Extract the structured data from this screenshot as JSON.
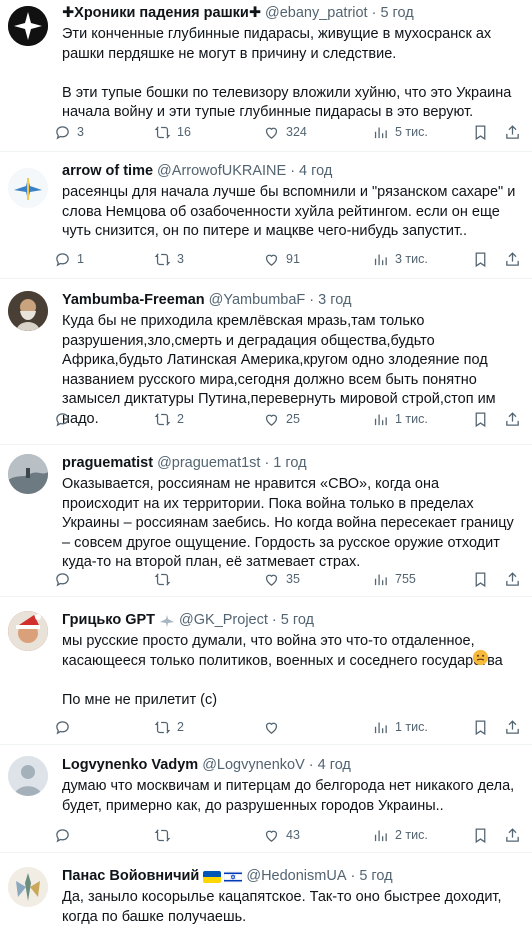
{
  "colors": {
    "text": "#0f1419",
    "muted": "#536471",
    "divider": "#eff3f4"
  },
  "icons": [
    "reply-icon",
    "retweet-icon",
    "like-icon",
    "views-icon",
    "bookmark-icon",
    "share-icon"
  ],
  "tweets": [
    {
      "name": "✚Хроники падения рашки✚",
      "handle": "@ebany_patriot",
      "separator": "·",
      "time": "5 год",
      "text": "Эти конченные глубинные пидарасы, живущие в мухосранск ах рашки пердяшке не могут в причину и следствие.\n\nВ эти тупые бошки по телевизору вложили хуйню, что это Украина начала войну и эти тупые глубинные пидарасы в это веруют.",
      "replies": "3",
      "retweets": "16",
      "likes": "324",
      "views": "5 тис."
    },
    {
      "name": "arrow of time",
      "handle": "@ArrowofUKRAINE",
      "separator": "·",
      "time": "4 год",
      "text": "расеянцы для начала лучше бы вспомнили и \"рязанском сахаре\" и слова Немцова об озабоченности хуйла рейтингом. если он еще чуть снизится, он по питере и мацкве чего-нибудь запустит..",
      "replies": "1",
      "retweets": "3",
      "likes": "91",
      "views": "3 тис."
    },
    {
      "name": "Yambumba-Freeman",
      "handle": "@YambumbaF",
      "separator": "·",
      "time": "3 год",
      "text": "Куда бы не приходила кремлёвская мразь,там только разрушения,зло,смерть и деградация общества,будьто Африка,будьто Латинская Америка,кругом одно злодеяние под названием русского мира,сегодня должно всем быть понятно замысел диктатуры Путина,перевернуть мировой строй,стоп им надо.",
      "replies": "",
      "retweets": "2",
      "likes": "25",
      "views": "1 тис."
    },
    {
      "name": "praguematist",
      "handle": "@praguemat1st",
      "separator": "·",
      "time": "1 год",
      "text": "Оказывается, россиянам не нравится «СВО», когда она происходит на их территории. Пока война только в пределах Украины – россиянам заебись. Но когда война пересекает границу – совсем другое ощущение. Гордость за русское оружие отходит куда-то на второй план, её затмевает страх.",
      "replies": "",
      "retweets": "",
      "likes": "35",
      "views": "755"
    },
    {
      "name": "Грицько GPT",
      "handle": "@GK_Project",
      "separator": "·",
      "time": "5 год",
      "text": "мы русские просто думали, что война это что-то отдаленное, касающееся только политиков, военных и соседнего государства \n\nПо мне не прилетит (с)",
      "replies": "",
      "retweets": "2",
      "likes": "",
      "views": "1 тис."
    },
    {
      "name": "Logvynenko Vadym",
      "handle": "@LogvynenkoV",
      "separator": "·",
      "time": "4 год",
      "text": "думаю что москвичам и питерцам до белгорода нет никакого дела, будет, примерно как, до разрушенных городов Украины..",
      "replies": "",
      "retweets": "",
      "likes": "43",
      "views": "2 тис."
    },
    {
      "name": "Панас Войовничий",
      "handle": "@HedonismUA",
      "separator": "·",
      "time": "5 год",
      "text": "Да, заныло косорылье кацапятское. Так-то оно быстрее доходит, когда по башке получаешь.",
      "replies": "",
      "retweets": "",
      "likes": "",
      "views": ""
    }
  ]
}
